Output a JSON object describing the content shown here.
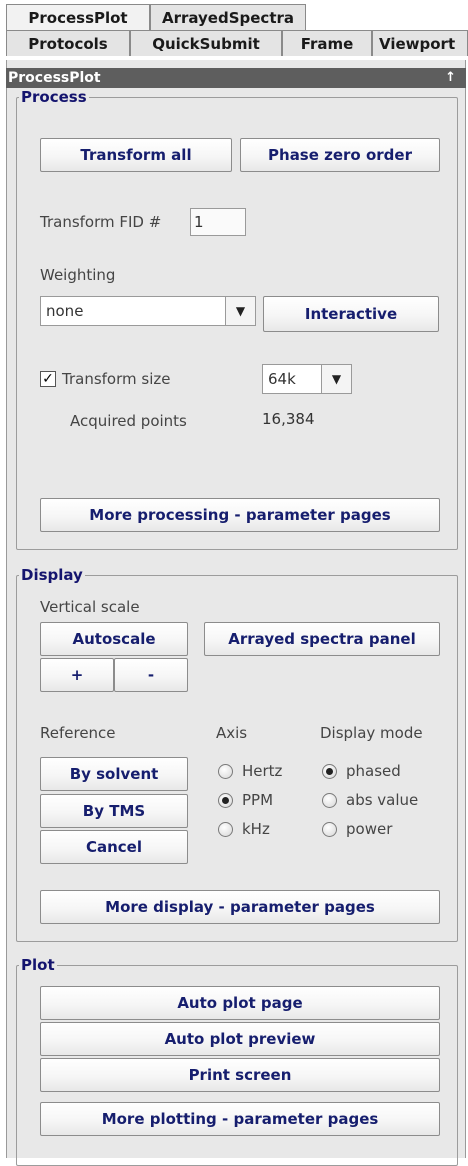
{
  "tabs_row1": [
    "ProcessPlot",
    "ArrayedSpectra"
  ],
  "tabs_row2": [
    "Protocols",
    "QuickSubmit",
    "Frame",
    "Viewport"
  ],
  "panel": {
    "title": "ProcessPlot",
    "pin_glyph": "↑"
  },
  "process": {
    "legend": "Process",
    "transform_all": "Transform all",
    "phase_zero_order": "Phase zero order",
    "transform_fid_label": "Transform FID #",
    "transform_fid_value": "1",
    "weighting_label": "Weighting",
    "weighting_value": "none",
    "interactive": "Interactive",
    "transform_size_checked": true,
    "transform_size_label": "Transform size",
    "transform_size_value": "64k",
    "acquired_points_label": "Acquired points",
    "acquired_points_value": "16,384",
    "more_processing": "More processing - parameter pages"
  },
  "display": {
    "legend": "Display",
    "vertical_scale_label": "Vertical scale",
    "autoscale": "Autoscale",
    "arrayed_spectra_panel": "Arrayed spectra panel",
    "plus": "+",
    "minus": "-",
    "reference_label": "Reference",
    "by_solvent": "By solvent",
    "by_tms": "By TMS",
    "cancel": "Cancel",
    "axis_label": "Axis",
    "axis_options": [
      "Hertz",
      "PPM",
      "kHz"
    ],
    "axis_selected": "PPM",
    "display_mode_label": "Display mode",
    "display_mode_options": [
      "phased",
      "abs value",
      "power"
    ],
    "display_mode_selected": "phased",
    "more_display": "More display - parameter pages"
  },
  "plot": {
    "legend": "Plot",
    "auto_plot_page": "Auto plot page",
    "auto_plot_preview": "Auto plot preview",
    "print_screen": "Print screen",
    "more_plotting": "More plotting - parameter pages"
  }
}
